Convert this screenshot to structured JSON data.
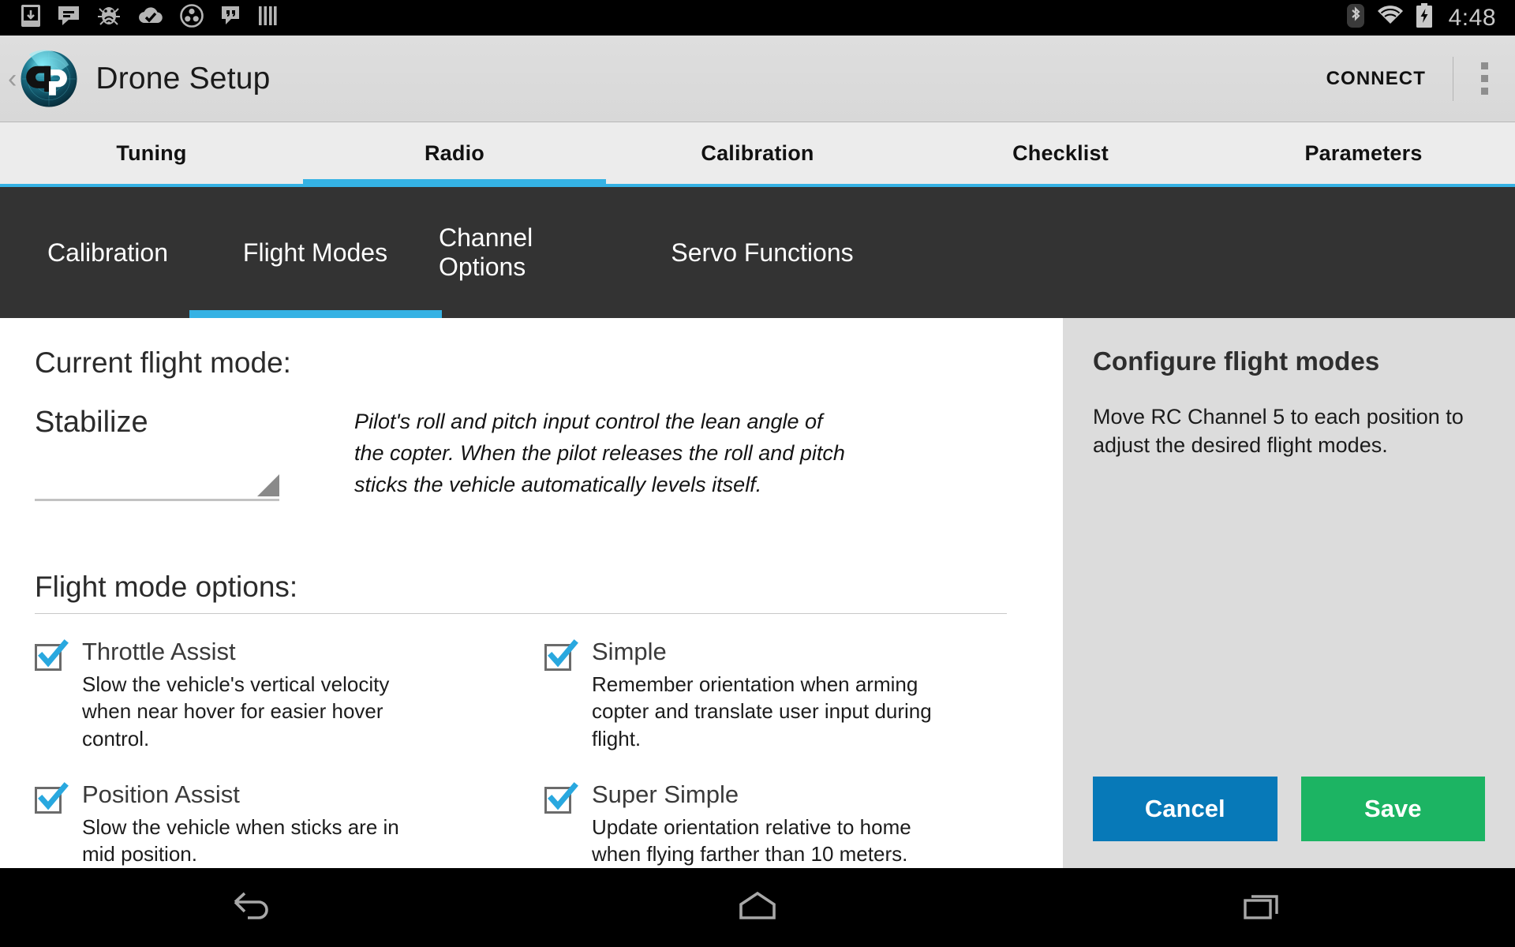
{
  "statusbar": {
    "left_icons": [
      "download-to-device-icon",
      "messaging-icon",
      "bug-wifi-icon",
      "cloud-check-icon",
      "circles-group-icon",
      "hangouts-icon",
      "bars-icon"
    ],
    "right_icons": [
      "bluetooth-icon",
      "wifi-icon",
      "battery-charging-icon"
    ],
    "time": "4:48"
  },
  "actionbar": {
    "back_glyph": "‹",
    "logo": "drone-setup-logo",
    "title": "Drone Setup",
    "connect_label": "CONNECT",
    "overflow": "overflow-menu-icon"
  },
  "primary_tabs": [
    {
      "label": "Tuning",
      "active": false
    },
    {
      "label": "Radio",
      "active": true
    },
    {
      "label": "Calibration",
      "active": false
    },
    {
      "label": "Checklist",
      "active": false
    },
    {
      "label": "Parameters",
      "active": false
    }
  ],
  "secondary_tabs": [
    {
      "label": "Calibration",
      "active": false
    },
    {
      "label": "Flight Modes",
      "active": true
    },
    {
      "label": "Channel Options",
      "active": false
    },
    {
      "label": "Servo Functions",
      "active": false
    }
  ],
  "main": {
    "current_mode_label": "Current flight mode:",
    "current_mode_value": "Stabilize",
    "mode_description": "Pilot's roll and pitch input control the lean angle of the copter.  When the pilot releases the roll and pitch sticks the vehicle automatically levels itself.",
    "options_title": "Flight mode options:",
    "options_left": [
      {
        "name": "Throttle Assist",
        "description": "Slow the vehicle's vertical velocity when near hover for easier hover control.",
        "checked": true
      },
      {
        "name": "Position Assist",
        "description": "Slow the vehicle when sticks are in mid position.",
        "checked": true
      }
    ],
    "options_right": [
      {
        "name": "Simple",
        "description": "Remember orientation when arming copter and translate user input during flight.",
        "checked": true
      },
      {
        "name": "Super Simple",
        "description": "Update orientation relative to home when flying farther than 10 meters.",
        "checked": true
      }
    ]
  },
  "side_panel": {
    "title": "Configure flight modes",
    "body": "Move RC Channel 5 to each position to adjust the desired flight modes.",
    "cancel_label": "Cancel",
    "save_label": "Save"
  },
  "navbar": {
    "back": "back-icon",
    "home": "home-icon",
    "recents": "recents-icon"
  },
  "colors": {
    "accent_cyan": "#35b2e4",
    "cancel_blue": "#0779b8",
    "save_green": "#1cb463",
    "secondary_bar": "#333333",
    "side_panel_bg": "#dcdcdc"
  }
}
